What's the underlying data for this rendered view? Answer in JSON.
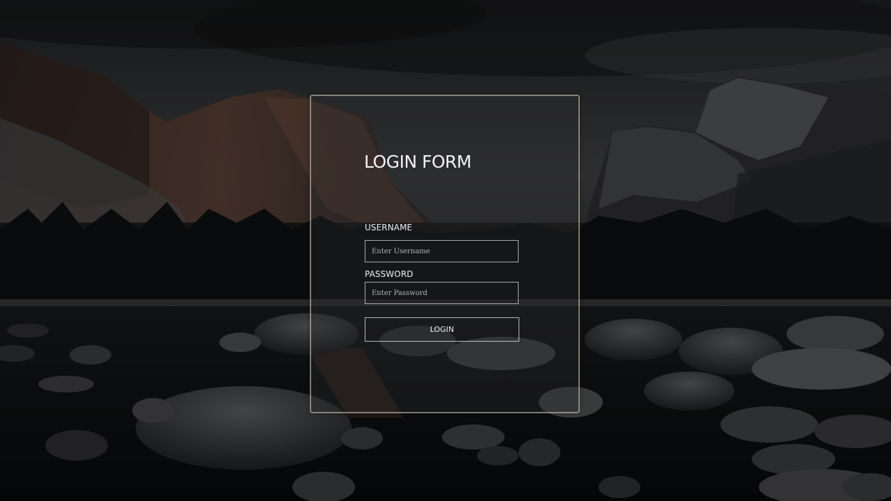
{
  "login_form": {
    "title": "LOGIN FORM",
    "username_label": "USERNAME",
    "username_placeholder": "Enter Username",
    "username_value": "",
    "password_label": "PASSWORD",
    "password_placeholder": "Enter Password",
    "password_value": "",
    "submit_label": "LOGIN"
  },
  "background": {
    "description_icon": "mountain-lake-landscape",
    "sky_color": "#3a3b3d",
    "rock_color": "#1c1d1f",
    "water_color": "#101214",
    "border_color": "#d7d4b9"
  }
}
